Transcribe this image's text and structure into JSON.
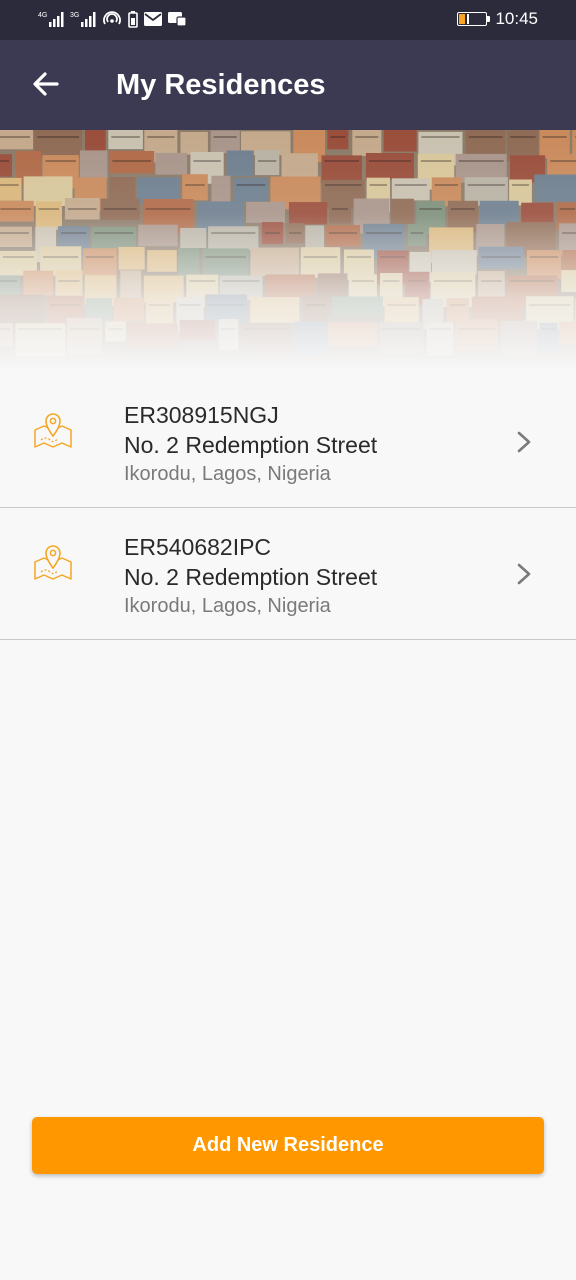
{
  "status_bar": {
    "time": "10:45",
    "icons": [
      "signal-4g-icon",
      "signal-3g-icon",
      "hotspot-icon",
      "battery-saver-icon",
      "mail-icon",
      "message-icon"
    ]
  },
  "header": {
    "title": "My Residences",
    "back_icon": "arrow-left-icon"
  },
  "residences": [
    {
      "code": "ER308915NGJ",
      "street": "No. 2 Redemption Street",
      "city": "Ikorodu, Lagos, Nigeria"
    },
    {
      "code": "ER540682IPC",
      "street": "No. 2 Redemption Street",
      "city": "Ikorodu, Lagos, Nigeria"
    }
  ],
  "add_button_label": "Add New Residence",
  "colors": {
    "accent": "#ff9800",
    "app_bar": "#3b3a52",
    "status_bar": "#2c2b3c",
    "icon": "#f5a623"
  }
}
